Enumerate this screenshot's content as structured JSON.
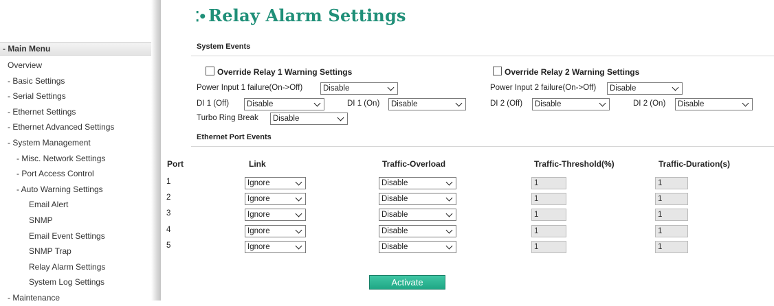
{
  "sidebar": {
    "header": "- Main Menu",
    "items": [
      {
        "label": "Overview",
        "indent": 1
      },
      {
        "label": "- Basic Settings",
        "indent": 1
      },
      {
        "label": "- Serial Settings",
        "indent": 1
      },
      {
        "label": "- Ethernet Settings",
        "indent": 1
      },
      {
        "label": "- Ethernet Advanced Settings",
        "indent": 1
      },
      {
        "label": "- System Management",
        "indent": 1
      },
      {
        "label": "- Misc. Network Settings",
        "indent": 2
      },
      {
        "label": "- Port Access Control",
        "indent": 2
      },
      {
        "label": "- Auto Warning Settings",
        "indent": 2
      },
      {
        "label": "Email Alert",
        "indent": 3
      },
      {
        "label": "SNMP",
        "indent": 3
      },
      {
        "label": "Email Event Settings",
        "indent": 3
      },
      {
        "label": "SNMP Trap",
        "indent": 3
      },
      {
        "label": "Relay Alarm Settings",
        "indent": 3
      },
      {
        "label": "System Log Settings",
        "indent": 3
      },
      {
        "label": "- Maintenance",
        "indent": 1
      }
    ]
  },
  "page": {
    "title": "Relay Alarm Settings",
    "title_icon": "dots-icon"
  },
  "system_events": {
    "label": "System Events",
    "relay1": {
      "override_label": "Override Relay 1 Warning Settings",
      "power_label": "Power Input 1 failure(On->Off)",
      "power_value": "Disable",
      "di_off_label": "DI 1 (Off)",
      "di_off_value": "Disable",
      "di_on_label": "DI 1 (On)",
      "di_on_value": "Disable",
      "turbo_label": "Turbo Ring Break",
      "turbo_value": "Disable"
    },
    "relay2": {
      "override_label": "Override Relay 2 Warning Settings",
      "power_label": "Power Input 2 failure(On->Off)",
      "power_value": "Disable",
      "di_off_label": "DI 2 (Off)",
      "di_off_value": "Disable",
      "di_on_label": "DI 2 (On)",
      "di_on_value": "Disable"
    }
  },
  "ethernet_port_events": {
    "label": "Ethernet Port Events",
    "columns": [
      "Port",
      "Link",
      "Traffic-Overload",
      "Traffic-Threshold(%)",
      "Traffic-Duration(s)"
    ],
    "rows": [
      {
        "port": "1",
        "link": "Ignore",
        "overload": "Disable",
        "threshold": "1",
        "duration": "1"
      },
      {
        "port": "2",
        "link": "Ignore",
        "overload": "Disable",
        "threshold": "1",
        "duration": "1"
      },
      {
        "port": "3",
        "link": "Ignore",
        "overload": "Disable",
        "threshold": "1",
        "duration": "1"
      },
      {
        "port": "4",
        "link": "Ignore",
        "overload": "Disable",
        "threshold": "1",
        "duration": "1"
      },
      {
        "port": "5",
        "link": "Ignore",
        "overload": "Disable",
        "threshold": "1",
        "duration": "1"
      }
    ]
  },
  "activate_label": "Activate",
  "colors": {
    "accent": "#1f8f78",
    "button": "#2bb893"
  }
}
